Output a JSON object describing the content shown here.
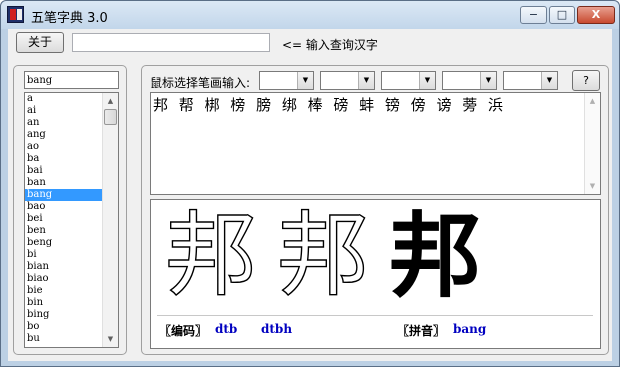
{
  "window": {
    "title": "五笔字典 3.0",
    "minimize_glyph": "−",
    "maximize_glyph": "□",
    "close_glyph": "X"
  },
  "toolbar": {
    "about_label": "关于",
    "query_value": "",
    "query_hint": "<= 输入查询汉字"
  },
  "pinyin": {
    "input_value": "bang",
    "items": [
      "a",
      "ai",
      "an",
      "ang",
      "ao",
      "ba",
      "bai",
      "ban",
      "bang",
      "bao",
      "bei",
      "ben",
      "beng",
      "bi",
      "bian",
      "biao",
      "bie",
      "bin",
      "bing",
      "bo",
      "bu"
    ],
    "selected": "bang"
  },
  "stroke": {
    "label": "鼠标选择笔画输入:",
    "selects": [
      "",
      "",
      "",
      "",
      ""
    ],
    "help_label": "?"
  },
  "result": {
    "characters": "邦 帮 梆 榜 膀 绑 棒 磅 蚌 镑 傍 谤 蒡 浜"
  },
  "glyph": {
    "character": "邦",
    "code_label": "〖编码〗",
    "codes": [
      "dtb",
      "dtbh"
    ],
    "pinyin_label": "〖拼音〗",
    "pinyin_value": "bang"
  },
  "icons": {
    "scroll_up": "▲",
    "scroll_down": "▼",
    "dropdown": "▼"
  }
}
